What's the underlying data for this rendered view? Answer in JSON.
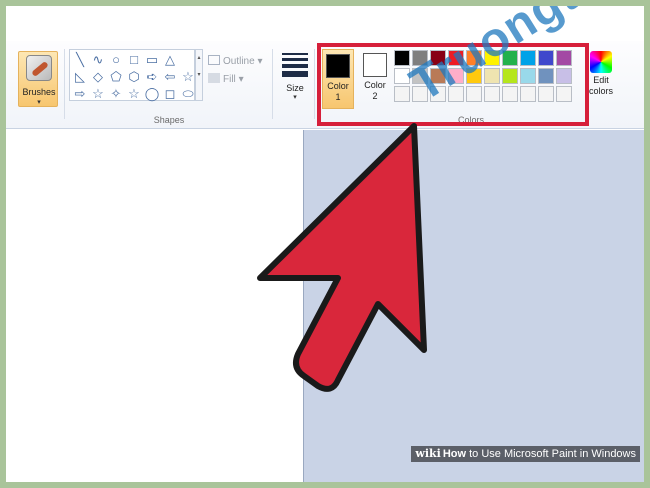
{
  "ribbon": {
    "brushes_label": "Brushes",
    "dropdown_glyph": "▾",
    "shapes_group_label": "Shapes",
    "shape_glyphs": [
      "╲",
      "∿",
      "○",
      "□",
      "▭",
      "△",
      "",
      "◺",
      "◇",
      "⬠",
      "⬡",
      "➪",
      "⇦",
      "☆",
      "⇨",
      "☆",
      "✧",
      "☆",
      "◯",
      "◻",
      "⬭"
    ],
    "outline_label": "Outline",
    "fill_label": "Fill",
    "size_label": "Size",
    "colors_group_label": "Colors",
    "color1_label_line1": "Color",
    "color1_label_line2": "1",
    "color2_label_line1": "Color",
    "color2_label_line2": "2",
    "edit_colors_line1": "Edit",
    "edit_colors_line2": "colors",
    "color1_value": "#000000",
    "color2_value": "#ffffff",
    "palette_row1": [
      "#000000",
      "#7f7f7f",
      "#880015",
      "#ed1c24",
      "#ff7f27",
      "#fff200",
      "#22b14c",
      "#00a2e8",
      "#3f48cc",
      "#a349a4"
    ],
    "palette_row2": [
      "#ffffff",
      "#c3c3c3",
      "#b97a57",
      "#ffaec9",
      "#ffc90e",
      "#efe4b0",
      "#b5e61d",
      "#99d9ea",
      "#7092be",
      "#c8bfe7"
    ],
    "palette_row3": [
      "#f4f4f4",
      "#f4f4f4",
      "#f4f4f4",
      "#f4f4f4",
      "#f4f4f4",
      "#f4f4f4",
      "#f4f4f4",
      "#f4f4f4",
      "#f4f4f4",
      "#f4f4f4"
    ],
    "highlight_color": "#d61f3a"
  },
  "overlay": {
    "watermark": "Truongthi.com.vn",
    "arrow_color": "#d9273b",
    "caption_wiki": "wiki",
    "caption_how": "How",
    "caption_rest": " to Use Microsoft Paint in Windows"
  }
}
